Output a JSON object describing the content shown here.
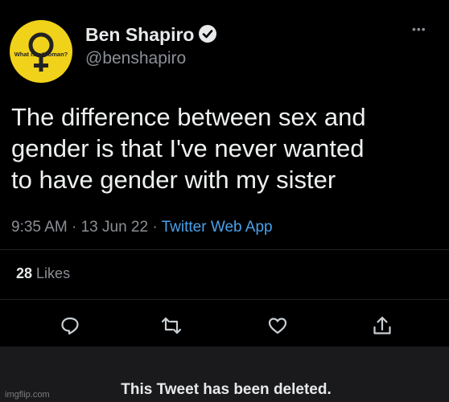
{
  "author": {
    "name": "Ben Shapiro",
    "handle": "@benshapiro",
    "avatar_text": "What is a Woman?"
  },
  "tweet": {
    "lines": [
      "The difference between sex and",
      "gender is that I've never wanted",
      "to have gender with my sister"
    ],
    "time": "9:35 AM",
    "date": "13 Jun 22",
    "app": "Twitter Web App",
    "likes_count": "28",
    "likes_label": "Likes"
  },
  "icons": {
    "more": "more-icon",
    "verified": "verified-badge-icon",
    "reply": "reply-icon",
    "retweet": "retweet-icon",
    "like": "heart-icon",
    "share": "share-icon"
  },
  "colors": {
    "background": "#000000",
    "link": "#4aa1eb",
    "avatar": "#f1d21b",
    "deleted_bar": "#1a1a1c"
  },
  "notice": "This Tweet has been deleted.",
  "watermark": "imgflip.com"
}
